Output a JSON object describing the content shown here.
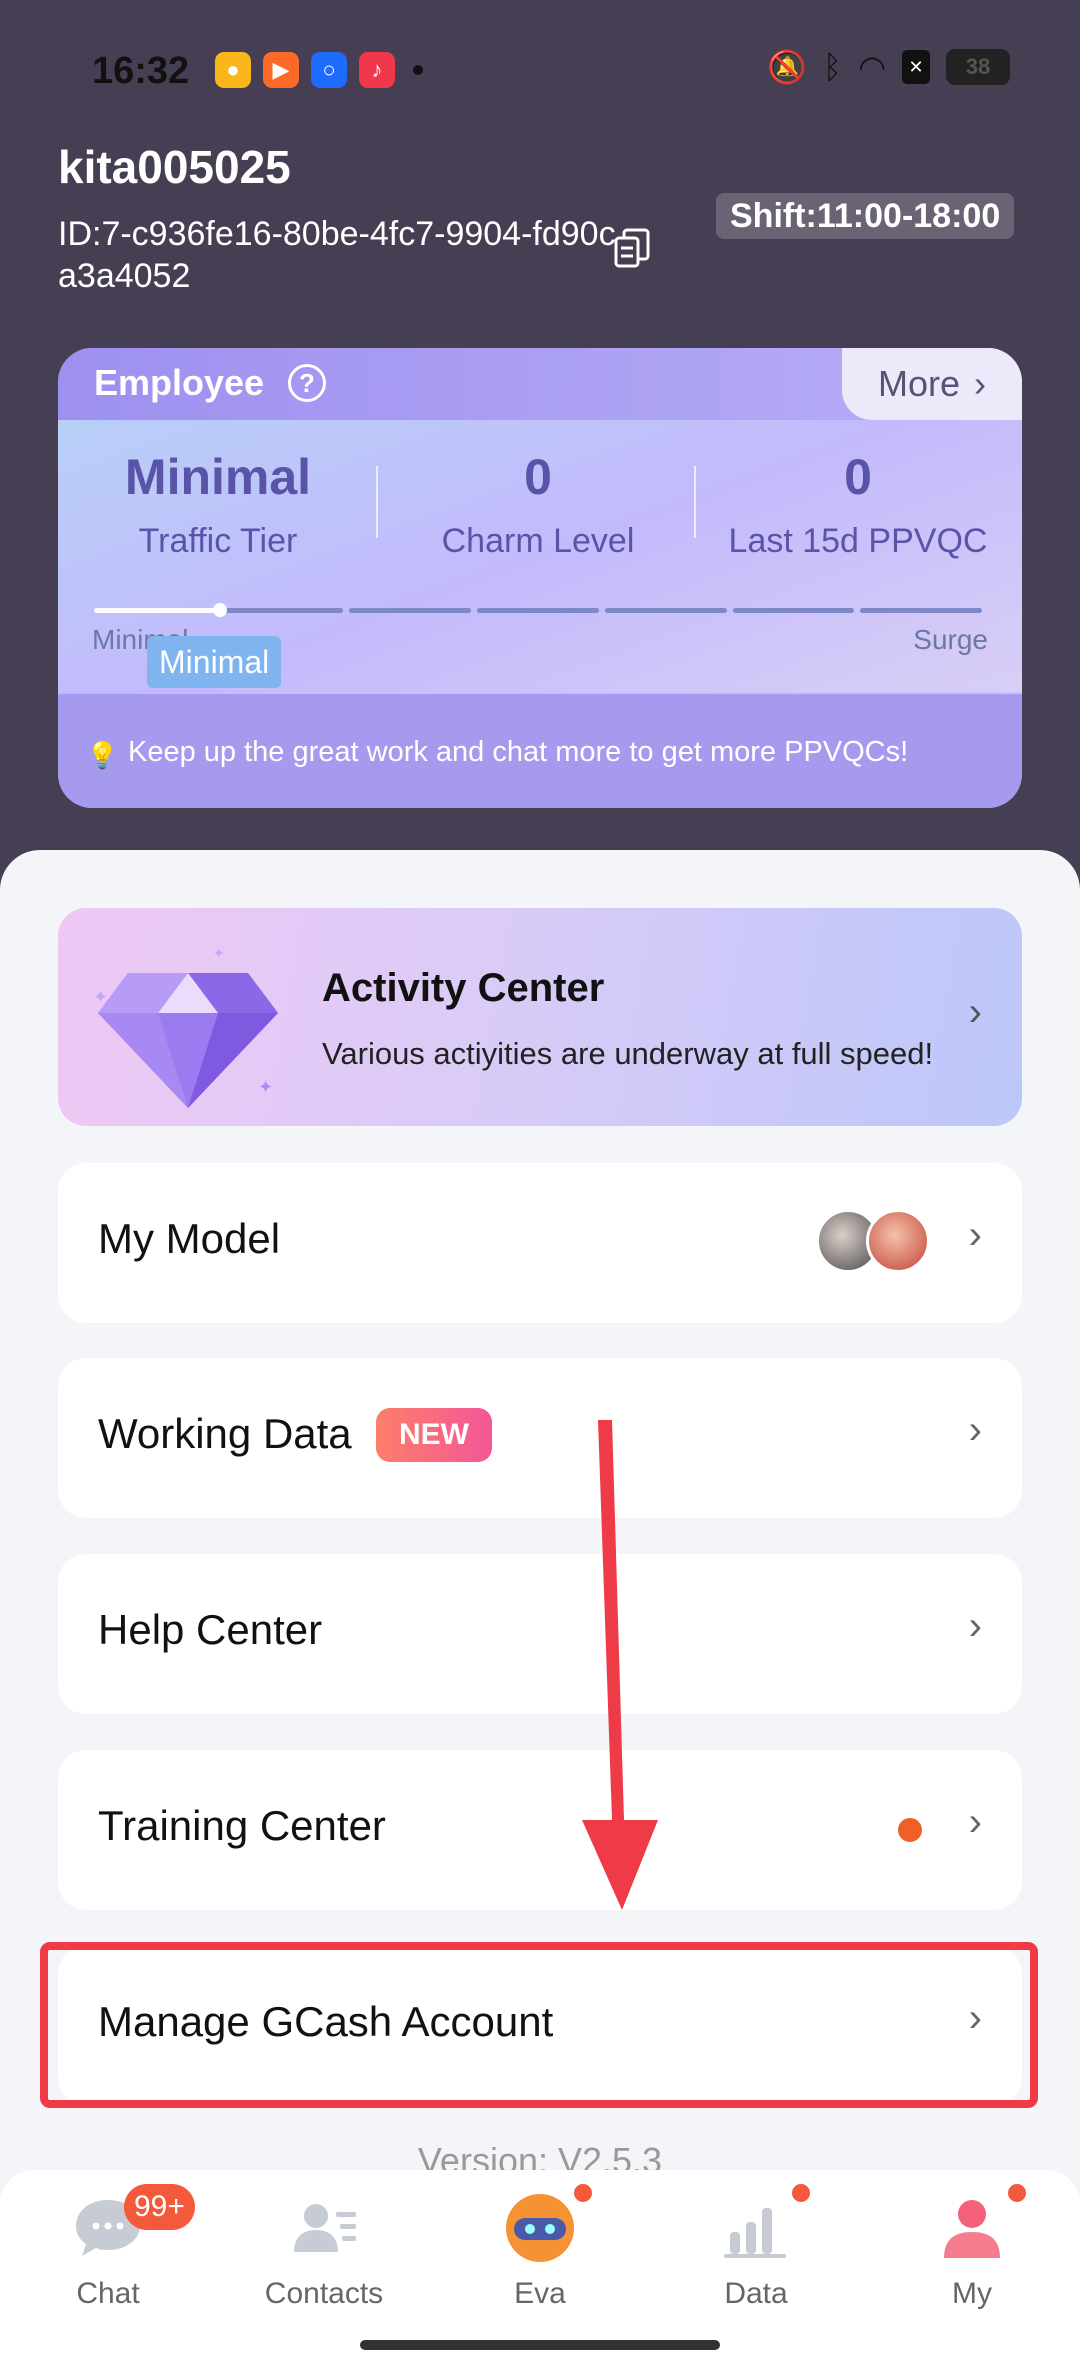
{
  "status_bar": {
    "time": "16:32",
    "battery": "38"
  },
  "profile": {
    "username": "kita005025",
    "id_text": "ID:7-c936fe16-80be-4fc7-9904-fd90ca3a4052",
    "shift": "Shift:11:00-18:00"
  },
  "employee_card": {
    "title": "Employee",
    "more_label": "More",
    "stats": [
      {
        "value": "Minimal",
        "label": "Traffic Tier"
      },
      {
        "value": "0",
        "label": "Charm Level"
      },
      {
        "value": "0",
        "label": "Last 15d PPVQC"
      }
    ],
    "tier_min_label": "Minimal",
    "tier_max_label": "Surge",
    "current_tier": "Minimal",
    "tier_progress": 0.15,
    "tip": "Keep up the great work and chat more to get more PPVQCs!"
  },
  "activity": {
    "title": "Activity Center",
    "subtitle": "Various actiyities are underway at full speed!"
  },
  "menu": {
    "my_model": "My Model",
    "working_data": "Working Data",
    "new_badge": "NEW",
    "help_center": "Help Center",
    "training_center": "Training Center",
    "manage_gcash": "Manage GCash Account"
  },
  "version": "Version: V2.5.3",
  "tabs": {
    "chat": "Chat",
    "chat_badge": "99+",
    "contacts": "Contacts",
    "eva": "Eva",
    "data": "Data",
    "my": "My"
  },
  "colors": {
    "header_bg": "#463e52",
    "accent_red": "#ee3b47",
    "badge_orange": "#f5593b",
    "tier_text": "#5a54a8"
  }
}
